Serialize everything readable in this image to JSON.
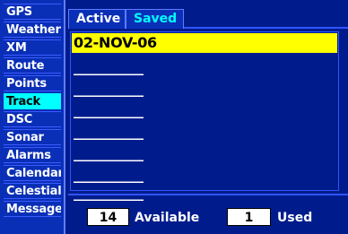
{
  "sidebar": {
    "items": [
      {
        "label": "GPS"
      },
      {
        "label": "Weather"
      },
      {
        "label": "XM"
      },
      {
        "label": "Route"
      },
      {
        "label": "Points"
      },
      {
        "label": "Track"
      },
      {
        "label": "DSC"
      },
      {
        "label": "Sonar"
      },
      {
        "label": "Alarms"
      },
      {
        "label": "Calendar"
      },
      {
        "label": "Celestial"
      },
      {
        "label": "Message"
      }
    ],
    "active_index": 5
  },
  "tabs": {
    "active_label": "Active",
    "saved_label": "Saved",
    "selected": "Saved"
  },
  "tracks": {
    "selected": "02-NOV-06",
    "empty_rows": [
      "___________",
      "___________",
      "___________",
      "___________",
      "___________",
      "___________",
      "___________"
    ]
  },
  "status": {
    "available_value": "14",
    "available_label": "Available",
    "used_value": "1",
    "used_label": "Used"
  },
  "colors": {
    "background": "#001c8c",
    "sidebar": "#0a2fb7",
    "highlight_cyan": "#00ffff",
    "highlight_yellow": "#ffff00"
  }
}
